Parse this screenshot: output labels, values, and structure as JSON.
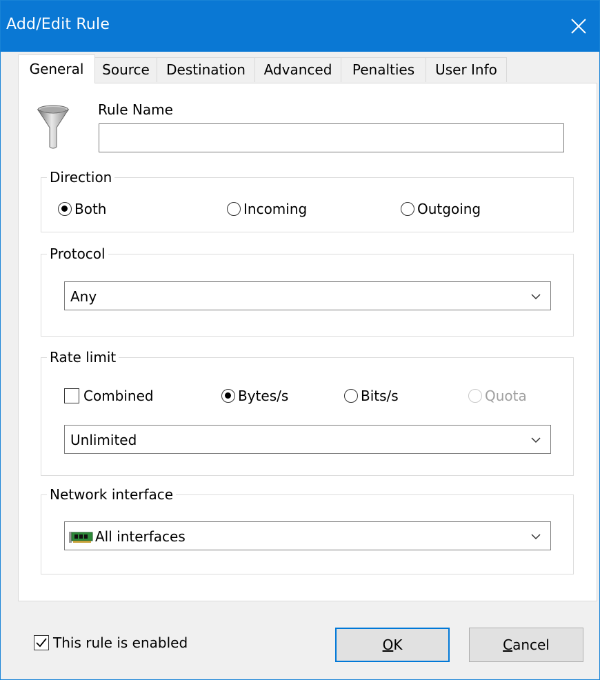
{
  "window": {
    "title": "Add/Edit Rule",
    "accent_color": "#0a78d4",
    "close_icon": "close-icon"
  },
  "tabs": [
    {
      "label": "General",
      "active": true
    },
    {
      "label": "Source",
      "active": false
    },
    {
      "label": "Destination",
      "active": false
    },
    {
      "label": "Advanced",
      "active": false
    },
    {
      "label": "Penalties",
      "active": false
    },
    {
      "label": "User Info",
      "active": false
    }
  ],
  "general": {
    "rule_icon": "funnel-icon",
    "rule_name_label": "Rule Name",
    "rule_name_value": "",
    "direction": {
      "legend": "Direction",
      "options": [
        {
          "label": "Both",
          "checked": true
        },
        {
          "label": "Incoming",
          "checked": false
        },
        {
          "label": "Outgoing",
          "checked": false
        }
      ]
    },
    "protocol": {
      "legend": "Protocol",
      "selected": "Any"
    },
    "rate_limit": {
      "legend": "Rate limit",
      "combined_label": "Combined",
      "combined_checked": false,
      "options": [
        {
          "label": "Bytes/s",
          "checked": true,
          "disabled": false
        },
        {
          "label": "Bits/s",
          "checked": false,
          "disabled": false
        },
        {
          "label": "Quota",
          "checked": false,
          "disabled": true
        }
      ],
      "selected": "Unlimited"
    },
    "network_interface": {
      "legend": "Network interface",
      "icon": "network-card-icon",
      "selected": "All interfaces"
    }
  },
  "footer": {
    "enabled_label": "This rule is enabled",
    "enabled_checked": true,
    "ok_label": "OK",
    "cancel_label": "Cancel"
  }
}
